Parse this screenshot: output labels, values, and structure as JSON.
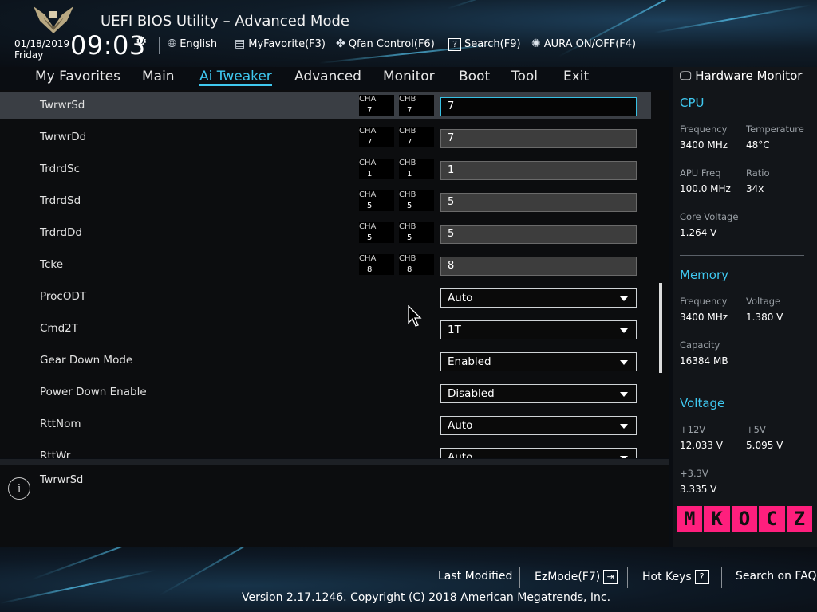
{
  "header": {
    "title": "UEFI BIOS Utility – Advanced Mode",
    "date": "01/18/2019",
    "day": "Friday",
    "time": "09:03",
    "buttons": [
      {
        "label": "English",
        "icon": "globe-icon"
      },
      {
        "label": "MyFavorite(F3)",
        "icon": "favorite-list-icon"
      },
      {
        "label": "Qfan Control(F6)",
        "icon": "fan-icon"
      },
      {
        "label": "Search(F9)",
        "icon": "search-help-icon"
      },
      {
        "label": "AURA ON/OFF(F4)",
        "icon": "aura-light-icon"
      }
    ]
  },
  "nav": {
    "tabs": [
      "My Favorites",
      "Main",
      "Ai Tweaker",
      "Advanced",
      "Monitor",
      "Boot",
      "Tool",
      "Exit"
    ],
    "active": "Ai Tweaker"
  },
  "settings": [
    {
      "label": "TwrwrSd",
      "cha": "7",
      "chb": "7",
      "value": "7"
    },
    {
      "label": "TwrwrDd",
      "cha": "7",
      "chb": "7",
      "value": "7"
    },
    {
      "label": "TrdrdSc",
      "cha": "1",
      "chb": "1",
      "value": "1"
    },
    {
      "label": "TrdrdSd",
      "cha": "5",
      "chb": "5",
      "value": "5"
    },
    {
      "label": "TrdrdDd",
      "cha": "5",
      "chb": "5",
      "value": "5"
    },
    {
      "label": "Tcke",
      "cha": "8",
      "chb": "8",
      "value": "8"
    },
    {
      "label": "ProcODT",
      "value": "Auto"
    },
    {
      "label": "Cmd2T",
      "value": "1T"
    },
    {
      "label": "Gear Down Mode",
      "value": "Enabled"
    },
    {
      "label": "Power Down Enable",
      "value": "Disabled"
    },
    {
      "label": "RttNom",
      "value": "Auto"
    },
    {
      "label": "RttWr",
      "value": "Auto"
    }
  ],
  "channel_labels": {
    "a": "CHA",
    "b": "CHB"
  },
  "help_text": "TwrwrSd",
  "hardware_monitor": {
    "title": "Hardware Monitor",
    "cpu": {
      "title": "CPU",
      "frequency_label": "Frequency",
      "frequency": "3400 MHz",
      "temperature_label": "Temperature",
      "temperature": "48°C",
      "apu_freq_label": "APU Freq",
      "apu_freq": "100.0 MHz",
      "ratio_label": "Ratio",
      "ratio": "34x",
      "core_voltage_label": "Core Voltage",
      "core_voltage": "1.264 V"
    },
    "memory": {
      "title": "Memory",
      "frequency_label": "Frequency",
      "frequency": "3400 MHz",
      "voltage_label": "Voltage",
      "voltage": "1.380 V",
      "capacity_label": "Capacity",
      "capacity": "16384 MB"
    },
    "voltage": {
      "title": "Voltage",
      "v12_label": "+12V",
      "v12": "12.033 V",
      "v5_label": "+5V",
      "v5": "5.095 V",
      "v33_label": "+3.3V",
      "v33": "3.335 V"
    }
  },
  "watermark": [
    "M",
    "K",
    "O",
    "C",
    "Z"
  ],
  "footer": {
    "last_modified": "Last Modified",
    "ezmode": "EzMode(F7)",
    "hotkeys": "Hot Keys",
    "search_faq": "Search on FAQ",
    "copyright": "Version 2.17.1246. Copyright (C) 2018 American Megatrends, Inc."
  },
  "colors": {
    "accent": "#3fc8f0",
    "selected_row": "#3a3e44",
    "watermark": "#ff1f7d"
  }
}
